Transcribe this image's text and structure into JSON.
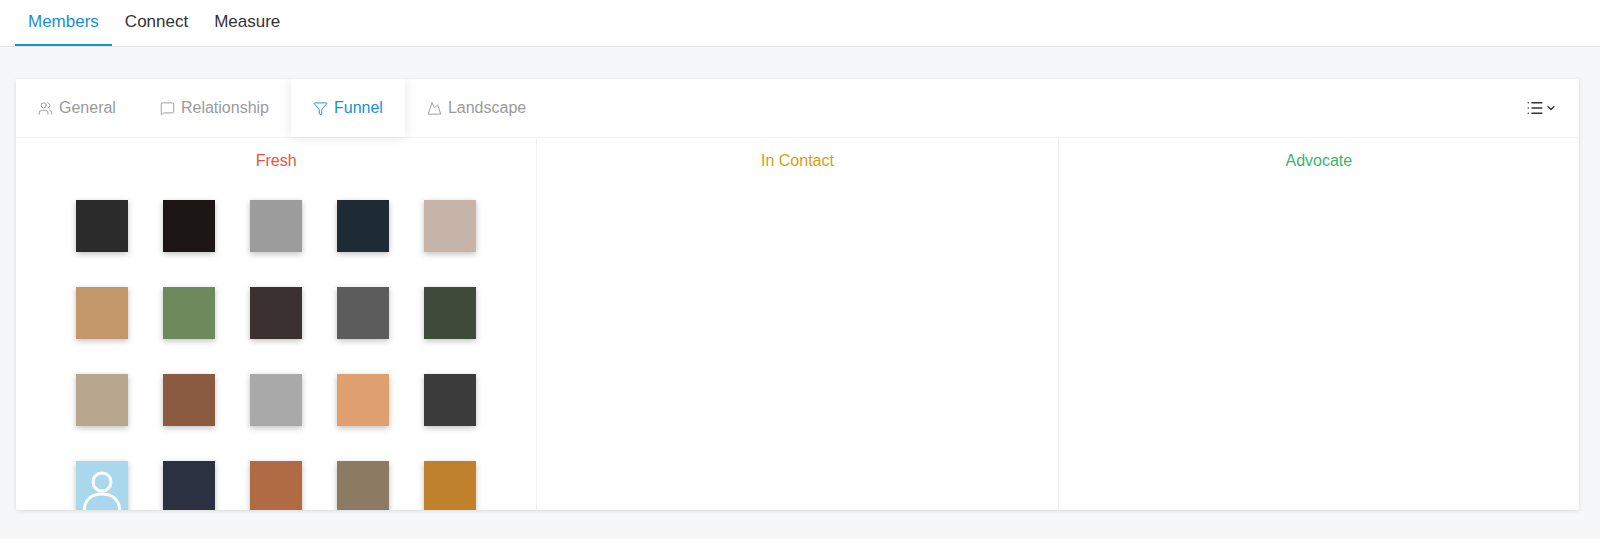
{
  "nav": [
    {
      "label": "Members",
      "selected": true
    },
    {
      "label": "Connect",
      "selected": false
    },
    {
      "label": "Measure",
      "selected": false
    }
  ],
  "view_tabs": [
    {
      "label": "General",
      "selected": false
    },
    {
      "label": "Relationship",
      "selected": false
    },
    {
      "label": "Funnel",
      "selected": true
    },
    {
      "label": "Landscape",
      "selected": false
    }
  ],
  "funnel": {
    "columns": [
      {
        "title": "Fresh",
        "color": "#e0583e",
        "members": [
          {
            "kind": "photo",
            "color": "#2b2b2b"
          },
          {
            "kind": "photo",
            "color": "#1b1515"
          },
          {
            "kind": "photo",
            "color": "#9c9c9c"
          },
          {
            "kind": "photo",
            "color": "#1f2b34"
          },
          {
            "kind": "photo",
            "color": "#c7b5aa"
          },
          {
            "kind": "photo",
            "color": "#c4976a"
          },
          {
            "kind": "photo",
            "color": "#6d8a5c"
          },
          {
            "kind": "photo",
            "color": "#3b3131"
          },
          {
            "kind": "photo",
            "color": "#5c5c5c"
          },
          {
            "kind": "photo",
            "color": "#3e4b3b"
          },
          {
            "kind": "photo",
            "color": "#b7a78f"
          },
          {
            "kind": "photo",
            "color": "#8b5b41"
          },
          {
            "kind": "photo",
            "color": "#a9a9a9"
          },
          {
            "kind": "photo",
            "color": "#df9f6f"
          },
          {
            "kind": "photo",
            "color": "#3b3b3b"
          },
          {
            "kind": "placeholder",
            "color": "#a9d8ec"
          },
          {
            "kind": "photo",
            "color": "#2b3141"
          },
          {
            "kind": "photo",
            "color": "#b06b42"
          },
          {
            "kind": "photo",
            "color": "#8b7b62"
          },
          {
            "kind": "photo",
            "color": "#c0812c"
          }
        ]
      },
      {
        "title": "In Contact",
        "color": "#d4a012",
        "members": []
      },
      {
        "title": "Advocate",
        "color": "#3cb46c",
        "members": []
      }
    ]
  }
}
